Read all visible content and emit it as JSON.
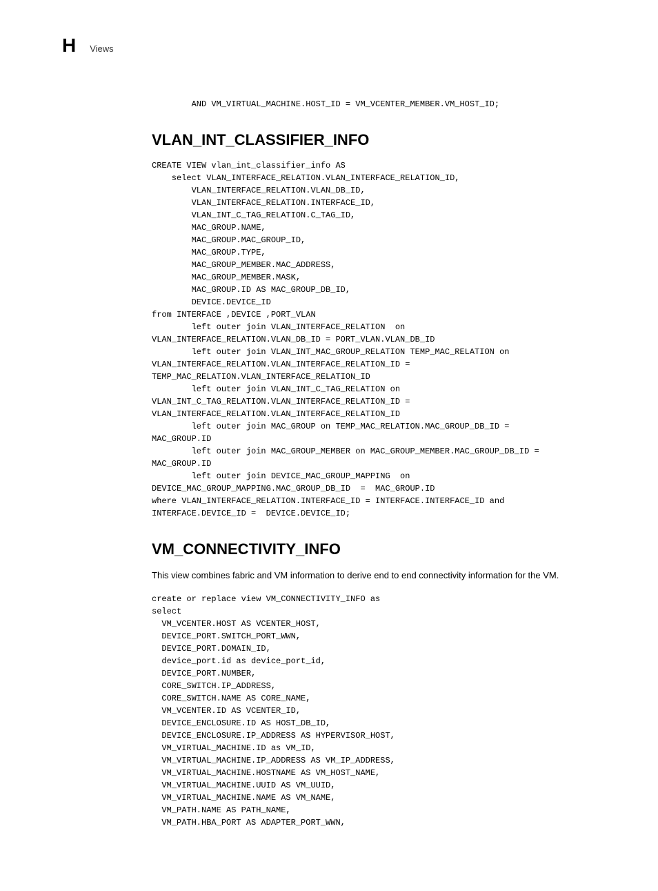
{
  "header": {
    "letter": "H",
    "title": "Views"
  },
  "section1": {
    "code_fragment": "        AND VM_VIRTUAL_MACHINE.HOST_ID = VM_VCENTER_MEMBER.VM_HOST_ID;"
  },
  "section2": {
    "heading": "VLAN_INT_CLASSIFIER_INFO",
    "code": "CREATE VIEW vlan_int_classifier_info AS\n    select VLAN_INTERFACE_RELATION.VLAN_INTERFACE_RELATION_ID,\n        VLAN_INTERFACE_RELATION.VLAN_DB_ID,\n        VLAN_INTERFACE_RELATION.INTERFACE_ID,\n        VLAN_INT_C_TAG_RELATION.C_TAG_ID,\n        MAC_GROUP.NAME,\n        MAC_GROUP.MAC_GROUP_ID,\n        MAC_GROUP.TYPE,\n        MAC_GROUP_MEMBER.MAC_ADDRESS,\n        MAC_GROUP_MEMBER.MASK,\n        MAC_GROUP.ID AS MAC_GROUP_DB_ID,\n        DEVICE.DEVICE_ID\nfrom INTERFACE ,DEVICE ,PORT_VLAN\n        left outer join VLAN_INTERFACE_RELATION  on \nVLAN_INTERFACE_RELATION.VLAN_DB_ID = PORT_VLAN.VLAN_DB_ID\n        left outer join VLAN_INT_MAC_GROUP_RELATION TEMP_MAC_RELATION on \nVLAN_INTERFACE_RELATION.VLAN_INTERFACE_RELATION_ID = \nTEMP_MAC_RELATION.VLAN_INTERFACE_RELATION_ID\n        left outer join VLAN_INT_C_TAG_RELATION on \nVLAN_INT_C_TAG_RELATION.VLAN_INTERFACE_RELATION_ID = \nVLAN_INTERFACE_RELATION.VLAN_INTERFACE_RELATION_ID\n        left outer join MAC_GROUP on TEMP_MAC_RELATION.MAC_GROUP_DB_ID = \nMAC_GROUP.ID\n        left outer join MAC_GROUP_MEMBER on MAC_GROUP_MEMBER.MAC_GROUP_DB_ID = \nMAC_GROUP.ID\n        left outer join DEVICE_MAC_GROUP_MAPPING  on  \nDEVICE_MAC_GROUP_MAPPING.MAC_GROUP_DB_ID  =  MAC_GROUP.ID\nwhere VLAN_INTERFACE_RELATION.INTERFACE_ID = INTERFACE.INTERFACE_ID and \nINTERFACE.DEVICE_ID =  DEVICE.DEVICE_ID;"
  },
  "section3": {
    "heading": "VM_CONNECTIVITY_INFO",
    "description": "This view combines fabric and VM information to derive end to end connectivity information for the VM.",
    "code": "create or replace view VM_CONNECTIVITY_INFO as\nselect\n  VM_VCENTER.HOST AS VCENTER_HOST,\n  DEVICE_PORT.SWITCH_PORT_WWN,\n  DEVICE_PORT.DOMAIN_ID,\n  device_port.id as device_port_id,\n  DEVICE_PORT.NUMBER,\n  CORE_SWITCH.IP_ADDRESS,\n  CORE_SWITCH.NAME AS CORE_NAME,\n  VM_VCENTER.ID AS VCENTER_ID,\n  DEVICE_ENCLOSURE.ID AS HOST_DB_ID,\n  DEVICE_ENCLOSURE.IP_ADDRESS AS HYPERVISOR_HOST,\n  VM_VIRTUAL_MACHINE.ID as VM_ID,\n  VM_VIRTUAL_MACHINE.IP_ADDRESS AS VM_IP_ADDRESS,\n  VM_VIRTUAL_MACHINE.HOSTNAME AS VM_HOST_NAME,\n  VM_VIRTUAL_MACHINE.UUID AS VM_UUID,\n  VM_VIRTUAL_MACHINE.NAME AS VM_NAME,\n  VM_PATH.NAME AS PATH_NAME,\n  VM_PATH.HBA_PORT AS ADAPTER_PORT_WWN,"
  }
}
